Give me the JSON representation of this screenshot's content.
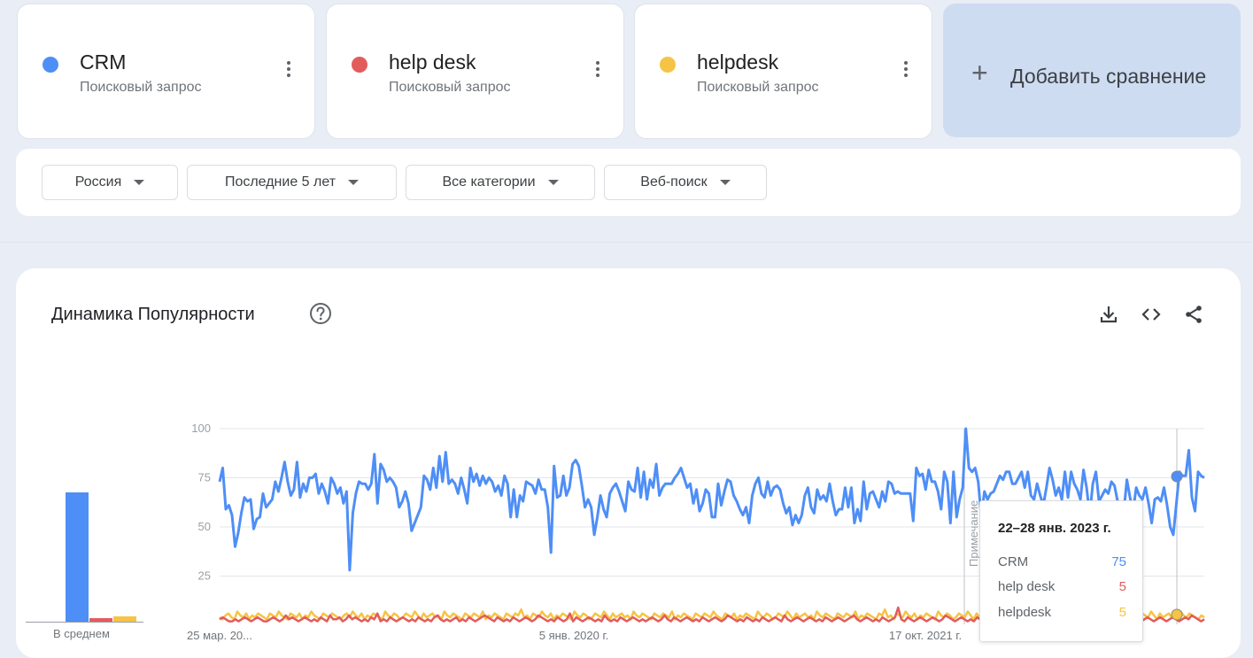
{
  "terms": [
    {
      "name": "CRM",
      "type": "Поисковый запрос",
      "color": "#4e8ef7"
    },
    {
      "name": "help desk",
      "type": "Поисковый запрос",
      "color": "#e25c5c"
    },
    {
      "name": "helpdesk",
      "type": "Поисковый запрос",
      "color": "#f6c444"
    }
  ],
  "add_compare": {
    "label": "Добавить сравнение"
  },
  "filters": {
    "region": "Россия",
    "period": "Последние 5 лет",
    "category": "Все категории",
    "search_type": "Веб-поиск"
  },
  "panel": {
    "title": "Динамика Популярности",
    "average_label": "В среднем",
    "note_label": "Примечание"
  },
  "tooltip": {
    "date": "22–28 янв. 2023 г.",
    "rows": [
      {
        "name": "CRM",
        "value": "75"
      },
      {
        "name": "help desk",
        "value": "5"
      },
      {
        "name": "helpdesk",
        "value": "5"
      }
    ]
  },
  "chart_data": {
    "type": "line",
    "y_ticks": [
      "100",
      "75",
      "50",
      "25"
    ],
    "ylim": [
      0,
      100
    ],
    "x_tick_labels": [
      "25 мар. 20...",
      "5 янв. 2020 г.",
      "17 окт. 2021 г."
    ],
    "grid": true,
    "average": {
      "CRM": 67,
      "help desk": 2,
      "helpdesk": 3
    },
    "series": [
      {
        "name": "CRM",
        "color": "#4e8ef7",
        "values": [
          73,
          80,
          59,
          61,
          56,
          40,
          47,
          57,
          65,
          63,
          64,
          49,
          54,
          55,
          67,
          60,
          62,
          64,
          73,
          68,
          75,
          83,
          73,
          66,
          69,
          83,
          65,
          72,
          68,
          75,
          75,
          77,
          67,
          72,
          68,
          62,
          75,
          72,
          67,
          70,
          62,
          68,
          28,
          57,
          67,
          73,
          72,
          72,
          69,
          72,
          87,
          62,
          82,
          79,
          73,
          75,
          73,
          70,
          60,
          63,
          68,
          62,
          48,
          52,
          56,
          60,
          76,
          74,
          69,
          80,
          70,
          86,
          73,
          88,
          72,
          74,
          72,
          67,
          75,
          69,
          62,
          80,
          73,
          77,
          71,
          76,
          72,
          75,
          73,
          68,
          71,
          66,
          76,
          72,
          55,
          69,
          55,
          66,
          63,
          73,
          72,
          71,
          67,
          74,
          69,
          69,
          60,
          37,
          81,
          65,
          66,
          76,
          66,
          70,
          82,
          84,
          81,
          71,
          60,
          64,
          60,
          46,
          55,
          66,
          59,
          55,
          67,
          70,
          72,
          68,
          63,
          58,
          73,
          69,
          68,
          80,
          65,
          78,
          64,
          74,
          70,
          82,
          66,
          70,
          72,
          72,
          72,
          75,
          77,
          80,
          75,
          70,
          72,
          62,
          69,
          58,
          62,
          69,
          67,
          55,
          55,
          72,
          61,
          68,
          74,
          73,
          66,
          63,
          59,
          56,
          60,
          52,
          66,
          72,
          75,
          67,
          65,
          73,
          66,
          70,
          71,
          69,
          62,
          57,
          60,
          51,
          56,
          52,
          56,
          66,
          70,
          60,
          57,
          69,
          64,
          66,
          63,
          72,
          63,
          56,
          59,
          59,
          70,
          60,
          70,
          52,
          59,
          53,
          73,
          59,
          67,
          68,
          64,
          60,
          68,
          63,
          73,
          72,
          67,
          68,
          67,
          67,
          67,
          67,
          53,
          80,
          76,
          77,
          69,
          79,
          73,
          73,
          68,
          59,
          78,
          73,
          52,
          78,
          55,
          64,
          70,
          100,
          80,
          78,
          80,
          73,
          55,
          68,
          64,
          67,
          68,
          72,
          76,
          74,
          78,
          78,
          72,
          72,
          75,
          78,
          70,
          78,
          66,
          64,
          72,
          66,
          61,
          70,
          80,
          74,
          66,
          70,
          64,
          78,
          65,
          78,
          72,
          69,
          64,
          79,
          70,
          56,
          72,
          78,
          63,
          66,
          69,
          67,
          73,
          71,
          63,
          56,
          58,
          74,
          65,
          58,
          70,
          66,
          64,
          70,
          62,
          52,
          64,
          65,
          63,
          70,
          61,
          50,
          46,
          62,
          78,
          76,
          76,
          89,
          65,
          58,
          78,
          76,
          75
        ]
      },
      {
        "name": "help desk",
        "color": "#e25c5c",
        "values": [
          3,
          4,
          3,
          2,
          2,
          3,
          2,
          3,
          4,
          3,
          2,
          3,
          4,
          3,
          2,
          2,
          3,
          4,
          3,
          2,
          3,
          5,
          3,
          4,
          3,
          2,
          3,
          4,
          3,
          2,
          3,
          2,
          4,
          3,
          2,
          5,
          3,
          3,
          4,
          2,
          3,
          5,
          3,
          4,
          3,
          2,
          3,
          2,
          4,
          3,
          6,
          2,
          3,
          2,
          4,
          3,
          2,
          3,
          4,
          3,
          2,
          3,
          2,
          4,
          3,
          2,
          3,
          2,
          4,
          5,
          3,
          2,
          3,
          2,
          3,
          4,
          2,
          3,
          2,
          4,
          3,
          2,
          3,
          4,
          5,
          4,
          3,
          2,
          4,
          3,
          2,
          3,
          2,
          4,
          3,
          2,
          3,
          4,
          3,
          2,
          3,
          5,
          4,
          3,
          2,
          3,
          2,
          4,
          3,
          2,
          3,
          6,
          2,
          4,
          3,
          2,
          3,
          4,
          3,
          2,
          3,
          2,
          5,
          3,
          2,
          3,
          2,
          4,
          3,
          2,
          3,
          4,
          3,
          2,
          3,
          2,
          3,
          4,
          3,
          2,
          3,
          5,
          3,
          2,
          4,
          3,
          2,
          3,
          4,
          3,
          2,
          3,
          2,
          4,
          3,
          2,
          3,
          4,
          3,
          2,
          3,
          5,
          4,
          3,
          2,
          3,
          2,
          4,
          3,
          2,
          3,
          2,
          4,
          3,
          2,
          3,
          4,
          3,
          2,
          5,
          3,
          2,
          3,
          4,
          3,
          2,
          3,
          4,
          3,
          2,
          3,
          2,
          4,
          3,
          2,
          3,
          4,
          3,
          2,
          3,
          4,
          5,
          3,
          2,
          3,
          4,
          3,
          2,
          3,
          2,
          4,
          3,
          2,
          3,
          4,
          9,
          3,
          2,
          4,
          3,
          2,
          3,
          4,
          3,
          2,
          3,
          4,
          3,
          2,
          3,
          5,
          4,
          3,
          2,
          3,
          4,
          3,
          2,
          3,
          2,
          4,
          3,
          2,
          3,
          4,
          3,
          2,
          3,
          2,
          4,
          3,
          2,
          3,
          4,
          5,
          3,
          2,
          3,
          2,
          4,
          3,
          2,
          3,
          4,
          3,
          2,
          3,
          4,
          3,
          2,
          3,
          2,
          4,
          3,
          2,
          3,
          4,
          3,
          2,
          3,
          2,
          4,
          3,
          2,
          3,
          4,
          3,
          2,
          3,
          2,
          4,
          3,
          2,
          3,
          4,
          3,
          2,
          3,
          4,
          3,
          2,
          3,
          4,
          3,
          2,
          3,
          4,
          3,
          5,
          4,
          3,
          2,
          3
        ]
      },
      {
        "name": "helpdesk",
        "color": "#f6c444",
        "values": [
          4,
          3,
          5,
          6,
          4,
          3,
          7,
          5,
          4,
          6,
          3,
          5,
          4,
          6,
          5,
          4,
          3,
          6,
          5,
          4,
          7,
          5,
          4,
          3,
          6,
          5,
          4,
          6,
          3,
          5,
          4,
          7,
          5,
          4,
          3,
          6,
          5,
          4,
          6,
          5,
          4,
          3,
          5,
          6,
          4,
          7,
          5,
          4,
          6,
          3,
          5,
          4,
          6,
          5,
          4,
          3,
          7,
          5,
          4,
          6,
          5,
          3,
          4,
          6,
          5,
          4,
          7,
          5,
          3,
          6,
          4,
          5,
          6,
          4,
          5,
          3,
          7,
          5,
          4,
          6,
          5,
          4,
          3,
          6,
          5,
          4,
          6,
          5,
          4,
          7,
          3,
          5,
          4,
          6,
          5,
          4,
          3,
          6,
          5,
          4,
          6,
          5,
          8,
          4,
          5,
          3,
          6,
          5,
          4,
          7,
          5,
          4,
          6,
          3,
          5,
          4,
          6,
          5,
          4,
          3,
          7,
          5,
          4,
          6,
          5,
          3,
          4,
          6,
          5,
          4,
          7,
          5,
          3,
          6,
          4,
          5,
          6,
          4,
          5,
          3,
          7,
          5,
          4,
          6,
          5,
          4,
          3,
          6,
          5,
          4,
          6,
          5,
          4,
          7,
          3,
          5,
          4,
          6,
          5,
          4,
          3,
          6,
          5,
          4,
          6,
          5,
          4,
          7,
          5,
          4,
          3,
          6,
          5,
          4,
          6,
          3,
          5,
          4,
          6,
          5,
          4,
          3,
          7,
          5,
          4,
          6,
          5,
          3,
          4,
          6,
          5,
          4,
          7,
          5,
          3,
          6,
          4,
          5,
          6,
          4,
          5,
          3,
          7,
          5,
          4,
          6,
          5,
          4,
          3,
          6,
          5,
          4,
          6,
          5,
          4,
          7,
          3,
          5,
          4,
          6,
          5,
          4,
          3,
          6,
          5,
          8,
          4,
          5,
          3,
          6,
          5,
          4,
          7,
          5,
          4,
          6,
          3,
          5,
          4,
          6,
          5,
          4,
          3,
          7,
          5,
          4,
          6,
          5,
          3,
          4,
          6,
          5,
          4,
          7,
          5,
          3,
          6,
          4,
          5,
          6,
          4,
          5,
          3,
          7,
          5,
          4,
          6,
          5,
          4,
          3,
          6,
          5,
          4,
          6,
          5,
          4,
          7,
          3,
          5,
          4,
          6,
          5,
          4,
          3,
          6,
          5,
          4,
          6,
          5,
          4,
          7,
          5,
          4,
          3,
          6,
          5,
          4,
          6,
          3,
          5,
          4,
          6,
          5,
          4,
          3,
          7,
          5,
          4,
          6,
          5,
          3,
          4,
          6,
          5,
          4,
          7,
          5,
          3,
          6,
          4,
          5,
          6,
          4,
          5,
          3,
          7,
          5,
          4,
          6,
          5,
          4,
          3,
          5,
          4
        ]
      }
    ]
  }
}
